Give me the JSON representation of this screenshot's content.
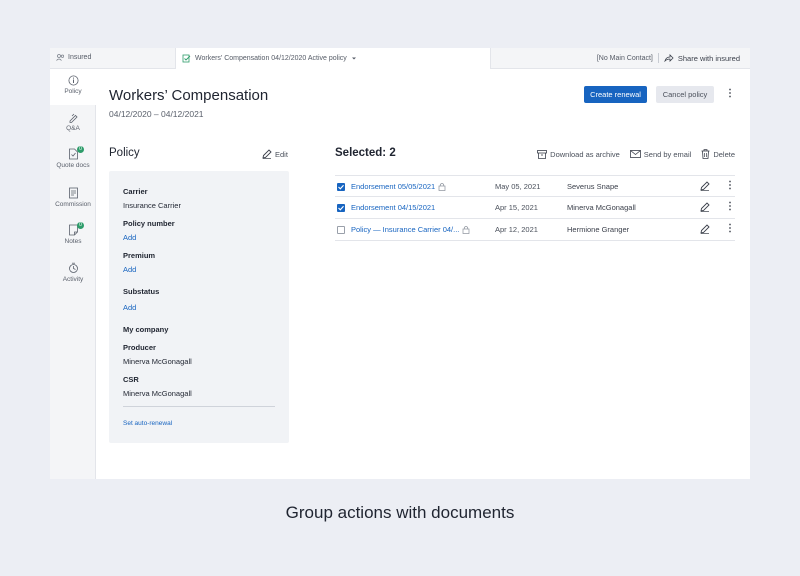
{
  "topbar": {
    "insured": "Insured",
    "policy_line": "Workers' Compensation  04/12/2020  Active policy",
    "contact": "[No Main Contact]",
    "share": "Share with insured"
  },
  "sidebar": {
    "items": [
      {
        "label": "Policy",
        "icon": "info-icon"
      },
      {
        "label": "Q&A",
        "icon": "qa-icon"
      },
      {
        "label": "Quote docs",
        "icon": "quote-docs-icon",
        "badge": "0"
      },
      {
        "label": "Commission",
        "icon": "commission-icon"
      },
      {
        "label": "Notes",
        "icon": "notes-icon",
        "badge": "0"
      },
      {
        "label": "Activity",
        "icon": "activity-icon"
      }
    ]
  },
  "header": {
    "title": "Workers’ Compensation",
    "dates": "04/12/2020 – 04/12/2021",
    "create_renewal": "Create renewal",
    "cancel_policy": "Cancel policy"
  },
  "policy_panel": {
    "heading": "Policy",
    "edit": "Edit",
    "carrier_label": "Carrier",
    "carrier_value": "Insurance Carrier",
    "policy_number_label": "Policy number",
    "policy_number_add": "Add",
    "premium_label": "Premium",
    "premium_add": "Add",
    "substatus_label": "Substatus",
    "substatus_add": "Add",
    "my_company_label": "My company",
    "producer_label": "Producer",
    "producer_value": "Minerva McGonagall",
    "csr_label": "CSR",
    "csr_value": "Minerva McGonagall",
    "auto_renewal": "Set auto-renewal"
  },
  "documents": {
    "selected": "Selected: 2",
    "download": "Download as archive",
    "send": "Send by email",
    "delete": "Delete",
    "rows": [
      {
        "name": "Endorsement 05/05/2021",
        "date": "May 05, 2021",
        "user": "Severus Snape",
        "checked": true
      },
      {
        "name": "Endorsement 04/15/2021",
        "date": "Apr 15, 2021",
        "user": "Minerva McGonagall",
        "checked": true
      },
      {
        "name": "Policy — Insurance Carrier 04/...",
        "date": "Apr 12, 2021",
        "user": "Hermione Granger",
        "checked": false
      }
    ]
  },
  "caption": "Group actions with documents",
  "colors": {
    "accent": "#1764c0",
    "badge": "#2d9c6a",
    "background": "#eceef4"
  }
}
